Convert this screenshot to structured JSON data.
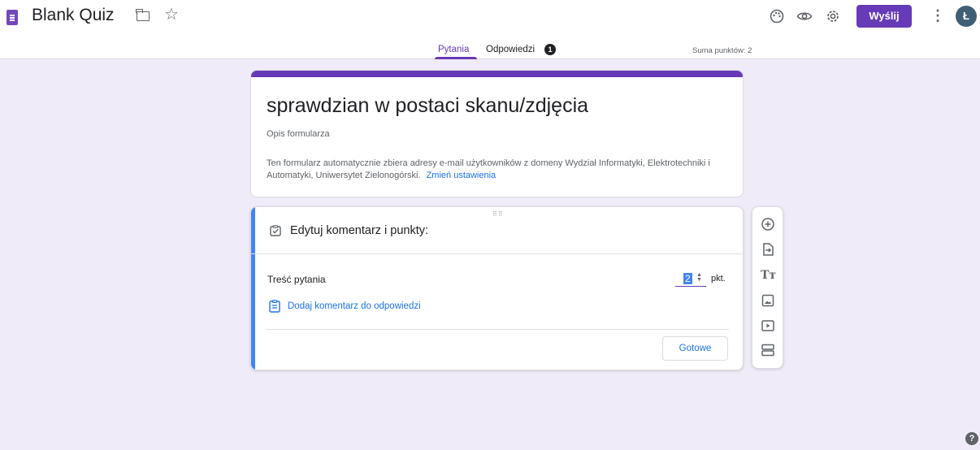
{
  "header": {
    "app_title": "Blank Quiz",
    "send_label": "Wyślij",
    "avatar_initial": "Ł"
  },
  "tabs": {
    "questions": "Pytania",
    "responses": "Odpowiedzi",
    "responses_count": "1",
    "total_points": "Suma punktów: 2"
  },
  "form": {
    "title": "sprawdzian w postaci skanu/zdjęcia",
    "description": "Opis formularza",
    "email_note": "Ten formularz automatycznie zbiera adresy e-mail użytkowników z domeny Wydział Informatyki, Elektrotechniki i Automatyki, Uniwersytet Zielonogórski.",
    "change_settings": "Zmień ustawienia"
  },
  "question_card": {
    "heading": "Edytuj komentarz i punkty:",
    "question_text": "Treść pytania",
    "points_value": "2",
    "points_unit": "pkt.",
    "add_comment": "Dodaj komentarz do odpowiedzi",
    "done_label": "Gotowe"
  },
  "colors": {
    "accent": "#673ab7",
    "background": "#f0ebf8",
    "link": "#1a73e8"
  }
}
